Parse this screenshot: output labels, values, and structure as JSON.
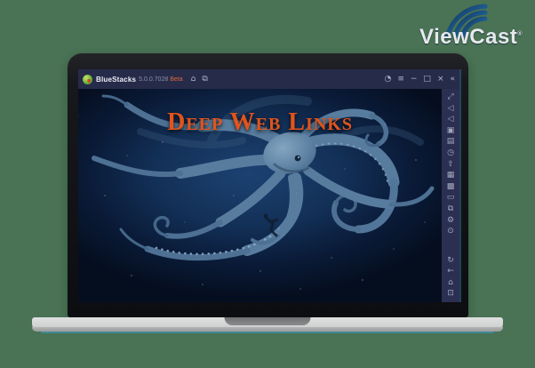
{
  "page": {
    "background_color": "#4a7254"
  },
  "viewcast": {
    "name": "ViewCast",
    "registered_mark": "®",
    "text_color": "#e6e9ec",
    "swoosh_colors": [
      "#16344f",
      "#1d5e95",
      "#2f81c2"
    ]
  },
  "laptop": {
    "bezel_color": "#101114",
    "base_color": "#d2d4d4",
    "base_accent_color": "#3f8c9d",
    "notch_color": "#7e8082"
  },
  "bluestacks": {
    "titlebar": {
      "app_name": "BlueStacks",
      "version": "5.0.0.7028",
      "channel": "Beta",
      "background_color": "#262b49",
      "left_icons": [
        {
          "name": "home-icon",
          "glyph": "⌂"
        },
        {
          "name": "multi-window-icon",
          "glyph": "⧉"
        }
      ],
      "right_icons": [
        {
          "name": "boost-icon",
          "glyph": "◔"
        },
        {
          "name": "menu-icon",
          "glyph": "≡"
        },
        {
          "name": "minimize-icon",
          "glyph": "−"
        },
        {
          "name": "maximize-icon",
          "glyph": "□"
        },
        {
          "name": "close-icon",
          "glyph": "×"
        },
        {
          "name": "collapse-sidebar-icon",
          "glyph": "«"
        }
      ]
    },
    "sidebar": {
      "background_color": "#2b3052",
      "top_icons": [
        {
          "name": "fullscreen-icon",
          "glyph": "⤢"
        },
        {
          "name": "volume-up-icon",
          "glyph": "◁"
        },
        {
          "name": "volume-down-icon",
          "glyph": "◁"
        },
        {
          "name": "screenshot-icon",
          "glyph": "▣"
        },
        {
          "name": "screen-record-icon",
          "glyph": "▤"
        },
        {
          "name": "macro-recorder-icon",
          "glyph": "◷"
        },
        {
          "name": "sync-icon",
          "glyph": "⇧"
        },
        {
          "name": "game-controls-icon",
          "glyph": "▦"
        },
        {
          "name": "shake-icon",
          "glyph": "▩"
        },
        {
          "name": "media-manager-icon",
          "glyph": "▭"
        },
        {
          "name": "multi-instance-icon",
          "glyph": "⧉"
        },
        {
          "name": "settings-icon",
          "glyph": "⚙"
        },
        {
          "name": "more-icon",
          "glyph": "⊙"
        }
      ],
      "bottom_icons": [
        {
          "name": "rotate-icon",
          "glyph": "↻"
        },
        {
          "name": "back-icon",
          "glyph": "←"
        },
        {
          "name": "nav-home-icon",
          "glyph": "⌂"
        },
        {
          "name": "recent-apps-icon",
          "glyph": "⊡"
        }
      ]
    },
    "screen": {
      "heading": "Deep Web Links",
      "heading_color": "#e2541b",
      "ocean_deep_color": "#050e1f",
      "ocean_glow_color": "#1c4272",
      "kraken_color": "#5b7fa0"
    }
  }
}
